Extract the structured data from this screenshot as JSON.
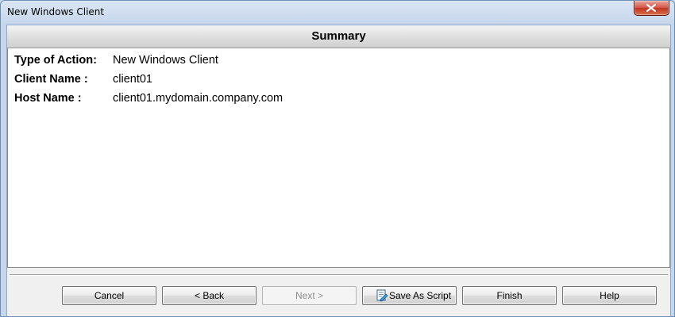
{
  "window": {
    "title": "New Windows Client"
  },
  "summary": {
    "header": "Summary",
    "rows": [
      {
        "label": "Type of Action:",
        "value": "New Windows Client"
      },
      {
        "label": "Client Name :",
        "value": "client01"
      },
      {
        "label": "Host Name :",
        "value": "client01.mydomain.company.com"
      }
    ]
  },
  "buttons": {
    "cancel": "Cancel",
    "back": "< Back",
    "next": "Next >",
    "save_as_script": "Save As Script",
    "finish": "Finish",
    "help": "Help"
  },
  "icons": {
    "close": "close-icon",
    "script": "script-icon"
  },
  "colors": {
    "window_frame": "#c5d6ec",
    "close_button": "#c23622",
    "panel_background": "#ffffff",
    "disabled_text": "#8c8c8c"
  }
}
